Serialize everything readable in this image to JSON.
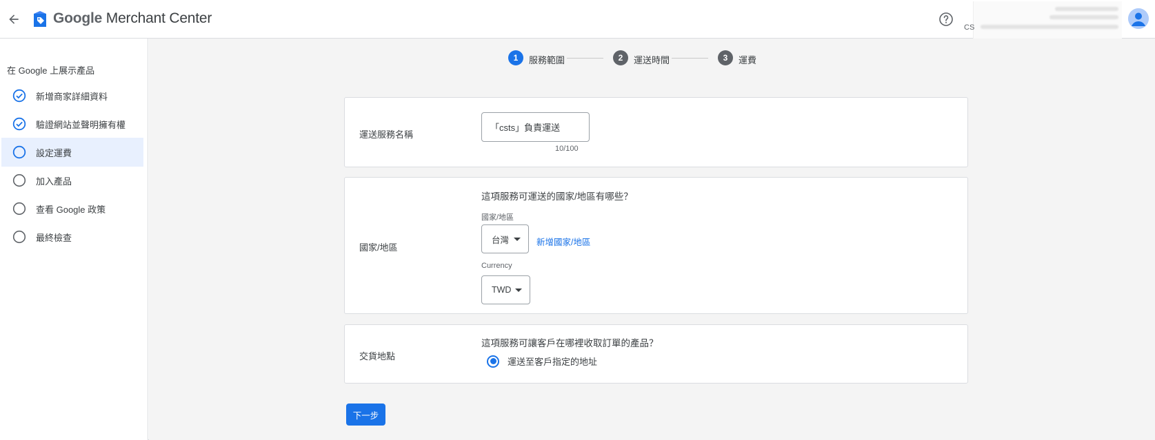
{
  "header": {
    "app_name_prefix": "Google",
    "app_name_suffix": " Merchant Center",
    "account_prefix": "CS"
  },
  "sidebar": {
    "heading": "在 Google 上展示產品",
    "items": [
      {
        "label": "新增商家詳細資料",
        "state": "done"
      },
      {
        "label": "驗證網站並聲明擁有權",
        "state": "done"
      },
      {
        "label": "設定運費",
        "state": "current"
      },
      {
        "label": "加入產品",
        "state": "todo"
      },
      {
        "label": "查看 Google 政策",
        "state": "todo"
      },
      {
        "label": "最終檢查",
        "state": "todo"
      }
    ]
  },
  "stepper": {
    "steps": [
      {
        "number": "1",
        "label": "服務範圍",
        "active": true
      },
      {
        "number": "2",
        "label": "運送時間",
        "active": false
      },
      {
        "number": "3",
        "label": "運費",
        "active": false
      }
    ]
  },
  "service_name": {
    "label": "運送服務名稱",
    "value": "「csts」負責運送",
    "counter": "10/100"
  },
  "country": {
    "label": "國家/地區",
    "question": "這項服務可運送的國家/地區有哪些？",
    "field_label": "國家/地區",
    "selected": "台灣",
    "add_link": "新增國家/地區",
    "currency_label": "Currency",
    "currency_selected": "TWD"
  },
  "delivery": {
    "label": "交貨地點",
    "question": "這項服務可讓客戶在哪裡收取訂單的產品？",
    "option": "運送至客戶指定的地址"
  },
  "actions": {
    "next": "下一步"
  },
  "colors": {
    "accent": "#1a73e8",
    "inactive_step": "#5f6368",
    "active_nav_bg": "#e8f0fe"
  }
}
